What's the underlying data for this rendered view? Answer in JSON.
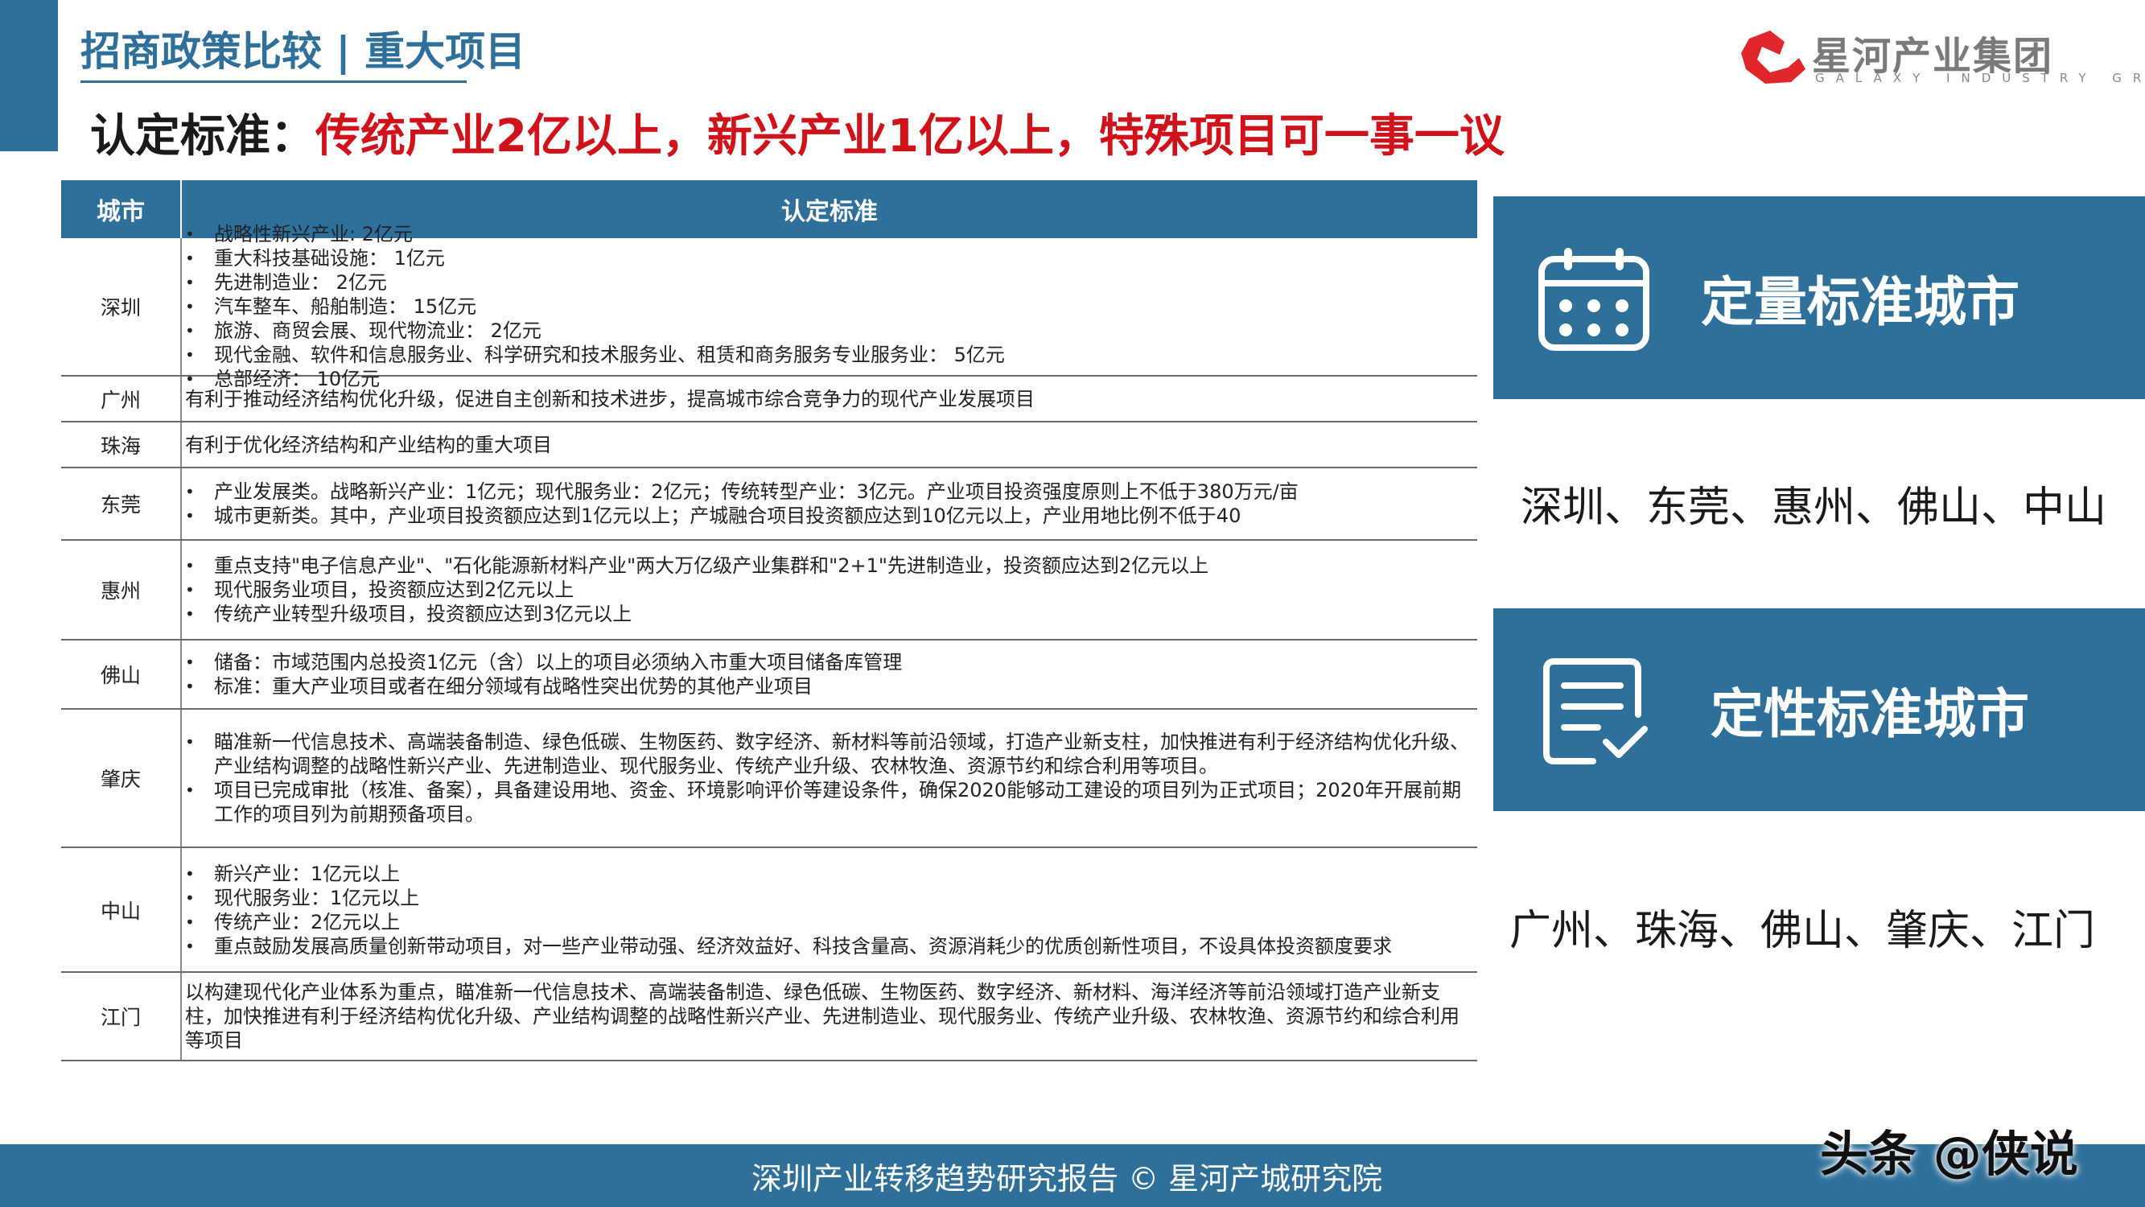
{
  "header": {
    "section_title": "招商政策比较 | 重大项目",
    "headline_prefix": "认定标准：",
    "headline_highlight": "传统产业2亿以上，新兴产业1亿以上，特殊项目可一事一议"
  },
  "logo": {
    "name": "星河产业集团",
    "subtitle": "GALAXY INDUSTRY GROUP"
  },
  "table": {
    "headers": [
      "城市",
      "认定标准"
    ],
    "rows": [
      {
        "city": "深圳",
        "items": [
          "战略性新兴产业: 2亿元",
          "重大科技基础设施： 1亿元",
          "先进制造业： 2亿元",
          "汽车整车、船舶制造： 15亿元",
          "旅游、商贸会展、现代物流业： 2亿元",
          "现代金融、软件和信息服务业、科学研究和技术服务业、租赁和商务服务专业服务业： 5亿元",
          "总部经济： 10亿元"
        ]
      },
      {
        "city": "广州",
        "text": "有利于推动经济结构优化升级，促进自主创新和技术进步，提高城市综合竞争力的现代产业发展项目"
      },
      {
        "city": "珠海",
        "text": "有利于优化经济结构和产业结构的重大项目"
      },
      {
        "city": "东莞",
        "items": [
          "产业发展类。战略新兴产业：1亿元；现代服务业：2亿元；传统转型产业：3亿元。产业项目投资强度原则上不低于380万元/亩",
          "城市更新类。其中，产业项目投资额应达到1亿元以上；产城融合项目投资额应达到10亿元以上，产业用地比例不低于40"
        ]
      },
      {
        "city": "惠州",
        "items": [
          "重点支持\"电子信息产业\"、\"石化能源新材料产业\"两大万亿级产业集群和\"2+1\"先进制造业，投资额应达到2亿元以上",
          "现代服务业项目，投资额应达到2亿元以上",
          "传统产业转型升级项目，投资额应达到3亿元以上"
        ]
      },
      {
        "city": "佛山",
        "items": [
          "储备：市域范围内总投资1亿元（含）以上的项目必须纳入市重大项目储备库管理",
          "标准：重大产业项目或者在细分领域有战略性突出优势的其他产业项目"
        ]
      },
      {
        "city": "肇庆",
        "items": [
          "瞄准新一代信息技术、高端装备制造、绿色低碳、生物医药、数字经济、新材料等前沿领域，打造产业新支柱，加快推进有利于经济结构优化升级、产业结构调整的战略性新兴产业、先进制造业、现代服务业、传统产业升级、农林牧渔、资源节约和综合利用等项目。",
          "项目已完成审批（核准、备案），具备建设用地、资金、环境影响评价等建设条件，确保2020能够动工建设的项目列为正式项目；2020年开展前期工作的项目列为前期预备项目。"
        ]
      },
      {
        "city": "中山",
        "items": [
          "新兴产业：1亿元以上",
          "现代服务业：1亿元以上",
          "传统产业：2亿元以上",
          "重点鼓励发展高质量创新带动项目，对一些产业带动强、经济效益好、科技含量高、资源消耗少的优质创新性项目，不设具体投资额度要求"
        ]
      },
      {
        "city": "江门",
        "text": "以构建现代化产业体系为重点，瞄准新一代信息技术、高端装备制造、绿色低碳、生物医药、数字经济、新材料、海洋经济等前沿领域打造产业新支柱，加快推进有利于经济结构优化升级、产业结构调整的战略性新兴产业、先进制造业、现代服务业、传统产业升级、农林牧渔、资源节约和综合利用等项目"
      }
    ]
  },
  "panels": [
    {
      "icon": "calendar-icon",
      "title": "定量标准城市",
      "cities": "深圳、东莞、惠州、佛山、中山"
    },
    {
      "icon": "document-check-icon",
      "title": "定性标准城市",
      "cities": "广州、珠海、佛山、肇庆、江门"
    }
  ],
  "footer": {
    "text": "深圳产业转移趋势研究报告 © 星河产城研究院"
  },
  "watermark_tag": "头条 @侠说",
  "colors": {
    "primary": "#2e7099",
    "highlight": "#d0121b",
    "logo_red": "#e0262b"
  }
}
